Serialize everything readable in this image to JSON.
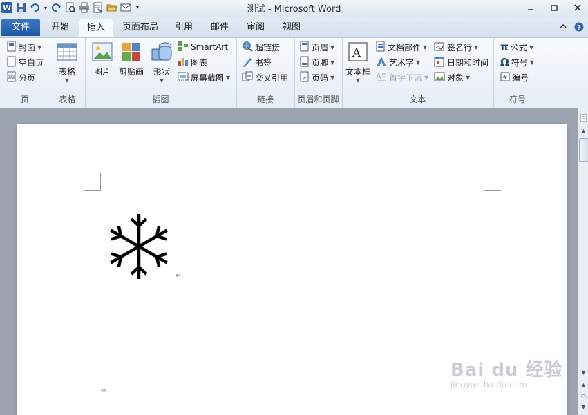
{
  "window": {
    "title": "测试 - Microsoft Word"
  },
  "tabs": [
    {
      "label": "文件"
    },
    {
      "label": "开始"
    },
    {
      "label": "插入"
    },
    {
      "label": "页面布局"
    },
    {
      "label": "引用"
    },
    {
      "label": "邮件"
    },
    {
      "label": "审阅"
    },
    {
      "label": "视图"
    }
  ],
  "active_tab": "插入",
  "ribbon": {
    "pages": {
      "label": "页",
      "cover": "封面",
      "blank_page": "空白页",
      "page_break": "分页"
    },
    "tables": {
      "label": "表格",
      "table": "表格"
    },
    "illustrations": {
      "label": "插图",
      "picture": "图片",
      "clipart": "剪贴画",
      "shapes": "形状",
      "smartart": "SmartArt",
      "chart": "图表",
      "screenshot": "屏幕截图"
    },
    "links": {
      "label": "链接",
      "hyperlink": "超链接",
      "bookmark": "书签",
      "cross_reference": "交叉引用"
    },
    "header_footer": {
      "label": "页眉和页脚",
      "header": "页眉",
      "footer": "页脚",
      "page_number": "页码"
    },
    "text": {
      "label": "文本",
      "textbox": "文本框",
      "quick_parts": "文档部件",
      "wordart": "艺术字",
      "drop_cap": "首字下沉",
      "signature_line": "签名行",
      "date_time": "日期和时间",
      "object": "对象"
    },
    "symbols": {
      "label": "符号",
      "equation": "公式",
      "symbol": "符号",
      "number": "编号"
    }
  },
  "document": {
    "paragraph_mark": "↵"
  },
  "watermark": {
    "main": "Bai du 经验",
    "sub": "jingyan.baidu.com"
  },
  "colors": {
    "file_tab": "#2a66b5",
    "ribbon_bg": "#eef3f9",
    "doc_bg": "#9aa3ae"
  }
}
